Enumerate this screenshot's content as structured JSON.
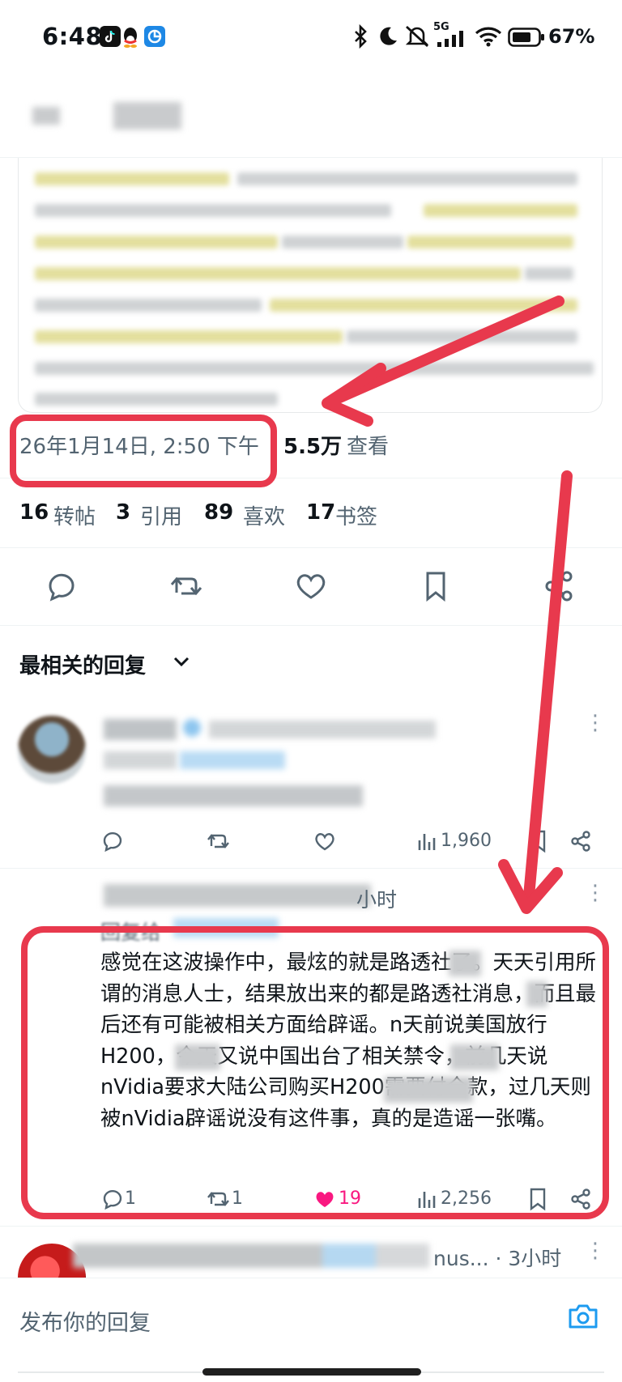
{
  "status_bar": {
    "time": "6:48",
    "network": "5G",
    "battery": "67%",
    "icons": [
      "tiktok-icon",
      "qq-icon",
      "app-icon",
      "bluetooth-icon",
      "moon-icon",
      "mute-icon",
      "signal-icon",
      "wifi-icon",
      "battery-icon"
    ]
  },
  "tweet": {
    "timestamp": "26年1月14日, 2:50 下午",
    "views_count": "5.5万",
    "views_label": "查看",
    "stats": [
      {
        "num": "16",
        "label": "转帖"
      },
      {
        "num": "3",
        "label": "引用"
      },
      {
        "num": "89",
        "label": "喜欢"
      },
      {
        "num": "17",
        "label": "书签"
      }
    ]
  },
  "replies_header": {
    "sort_label": "最相关的回复"
  },
  "reply1": {
    "views": "1,960"
  },
  "reply2": {
    "time_suffix": "小时",
    "reply_to_prefix": "回复给",
    "body": "感觉在这波操作中，最炫的就是路透社了。天天引用所谓的消息人士，结果放出来的都是路透社消息，而且最后还有可能被相关方面给辟谣。n天前说美国放行H200，今天又说中国出台了相关禁令，前几天说nVidia要求大陆公司购买H200需要付全款，过几天则被nVidia辟谣说没有这件事，真的是造谣一张嘴。",
    "replies": "1",
    "retweets": "1",
    "likes": "19",
    "views": "2,256"
  },
  "reply3": {
    "meta": "nus... · 3小时"
  },
  "composer": {
    "placeholder": "发布你的回复"
  },
  "colors": {
    "accent": "#1d9bf0",
    "annotation": "#e8394d",
    "like": "#f91880"
  }
}
